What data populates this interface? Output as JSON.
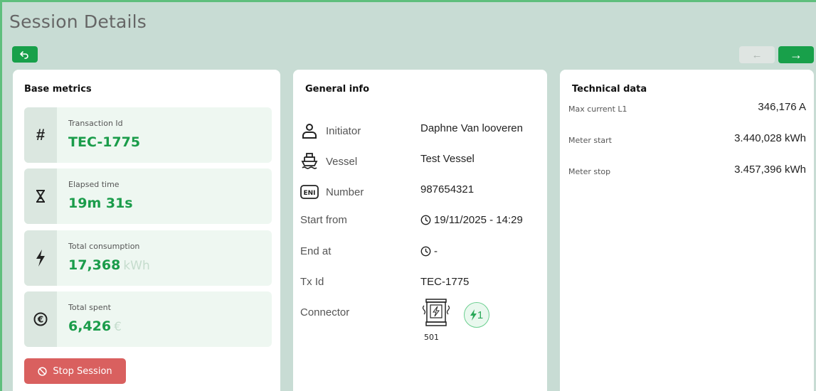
{
  "page": {
    "title": "Session Details"
  },
  "nav": {
    "back_icon": "undo-arrow-icon",
    "prev_icon": "arrow-left-icon",
    "next_icon": "arrow-right-icon"
  },
  "base_metrics": {
    "title": "Base metrics",
    "items": [
      {
        "icon": "hash-icon",
        "label": "Transaction Id",
        "value": "TEC-1775",
        "unit": ""
      },
      {
        "icon": "hourglass-icon",
        "label": "Elapsed time",
        "value": "19m 31s",
        "unit": ""
      },
      {
        "icon": "lightning-icon",
        "label": "Total consumption",
        "value": "17,368",
        "unit": "kWh"
      },
      {
        "icon": "euro-icon",
        "label": "Total spent",
        "value": "6,426",
        "unit": "€"
      }
    ],
    "stop_label": "Stop Session"
  },
  "general_info": {
    "title": "General info",
    "rows": [
      {
        "icon": "user-icon",
        "label": "Initiator",
        "value": "Daphne Van looveren"
      },
      {
        "icon": "ship-icon",
        "label": "Vessel",
        "value": "Test Vessel"
      },
      {
        "icon": "eni-icon",
        "label": "Number",
        "value": "987654321"
      },
      {
        "icon": "",
        "label": "Start from",
        "value": "19/11/2025 - 14:29"
      },
      {
        "icon": "",
        "label": "End at",
        "value": "-"
      },
      {
        "icon": "",
        "label": "Tx Id",
        "value": "TEC-1775"
      },
      {
        "icon": "",
        "label": "Connector",
        "value": ""
      }
    ],
    "eni_text": "ENI",
    "connector": {
      "station": "501",
      "connector_number": "1"
    }
  },
  "technical_data": {
    "title": "Technical data",
    "rows": [
      {
        "label": "Max current L1",
        "value": "346,176 A"
      },
      {
        "label": "Meter start",
        "value": "3.440,028 kWh"
      },
      {
        "label": "Meter stop",
        "value": "3.457,396 kWh"
      }
    ]
  },
  "colors": {
    "accent": "#18a04a",
    "danger": "#d9605f",
    "background": "#c8dcd4"
  }
}
